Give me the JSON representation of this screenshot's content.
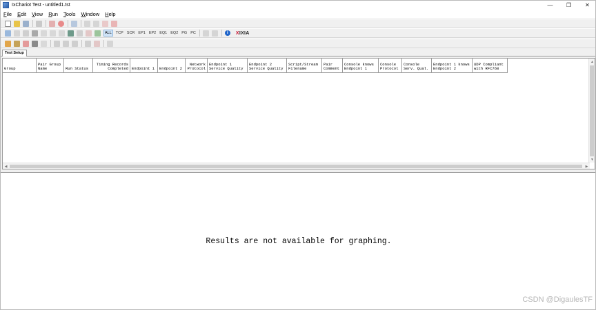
{
  "window": {
    "title": "IxChariot Test - untitled1.tst",
    "minimize_glyph": "—",
    "restore_glyph": "❐",
    "close_glyph": "✕"
  },
  "menu": [
    {
      "label_u": "F",
      "label_rest": "ile"
    },
    {
      "label_u": "E",
      "label_rest": "dit"
    },
    {
      "label_u": "V",
      "label_rest": "iew"
    },
    {
      "label_u": "R",
      "label_rest": "un"
    },
    {
      "label_u": "T",
      "label_rest": "ools"
    },
    {
      "label_u": "W",
      "label_rest": "indow"
    },
    {
      "label_u": "H",
      "label_rest": "elp"
    }
  ],
  "toolbar2": {
    "filters": [
      "ALL",
      "TCP",
      "SCR",
      "EP1",
      "EP2",
      "EQ1",
      "EQ2",
      "PG",
      "PC"
    ],
    "active_filter": "ALL",
    "logo": "XIXIA",
    "info_glyph": "i"
  },
  "tabs": {
    "test_setup": "Test Setup"
  },
  "grid": {
    "columns": [
      "Group",
      "Pair Group\nName",
      "Run Status",
      "Timing Records\nCompleted",
      "Endpoint 1",
      "Endpoint 2",
      "Network\nProtocol",
      "Endpoint 1\nService Quality",
      "Endpoint 2\nService Quality",
      "Script/Stream\nFilename",
      "Pair\nComment",
      "Console knows\nEndpoint 1",
      "Console\nProtocol",
      "Console\nServ. Qual.",
      "Endpoint 1 knows\nEndpoint 2",
      "UDP Compliant\nwith RFC768"
    ]
  },
  "graph": {
    "message": "Results are not available for graphing."
  },
  "watermark": "CSDN @DigaulesTF",
  "colors": {
    "accent": "#1d63c9",
    "active_bg": "#cfe3f7",
    "logo_red": "#c8102e"
  }
}
